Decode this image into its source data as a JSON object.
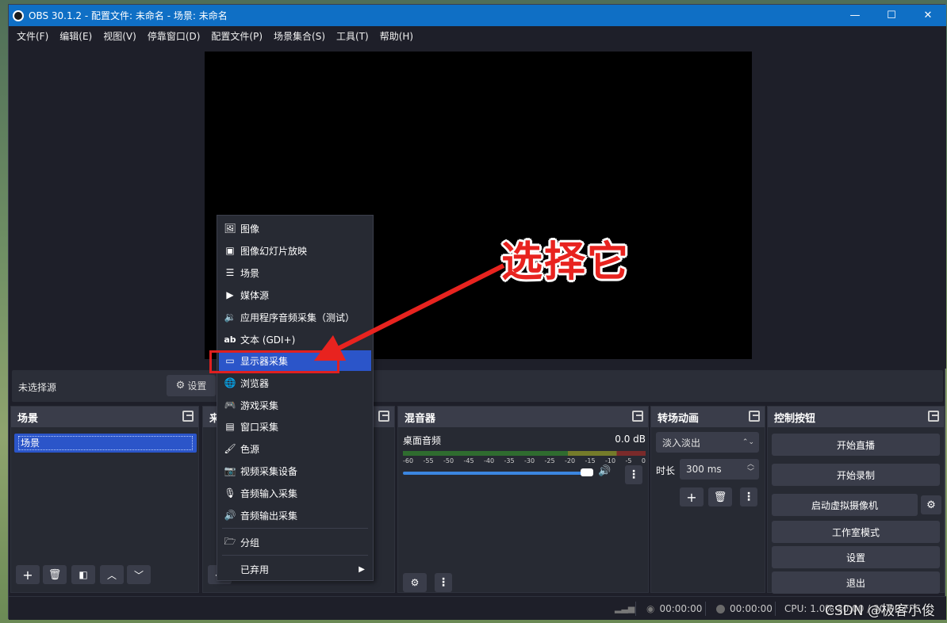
{
  "window": {
    "title": "OBS 30.1.2 - 配置文件: 未命名 - 场景: 未命名"
  },
  "menubar": [
    "文件(F)",
    "编辑(E)",
    "视图(V)",
    "停靠窗口(D)",
    "配置文件(P)",
    "场景集合(S)",
    "工具(T)",
    "帮助(H)"
  ],
  "source_bar": {
    "no_source": "未选择源",
    "settings": "设置"
  },
  "docks": {
    "scenes": {
      "title": "场景",
      "items": [
        "场景"
      ]
    },
    "sources": {
      "title": "来"
    },
    "mixer": {
      "title": "混音器",
      "track_name": "桌面音频",
      "track_db": "0.0 dB",
      "ticks": [
        "-60",
        "-55",
        "-50",
        "-45",
        "-40",
        "-35",
        "-30",
        "-25",
        "-20",
        "-15",
        "-10",
        "-5",
        "0"
      ],
      "volume_fraction": 1.0
    },
    "transitions": {
      "title": "转场动画",
      "transition": "淡入淡出",
      "duration_label": "时长",
      "duration": "300 ms"
    },
    "controls": {
      "title": "控制按钮",
      "buttons": [
        "开始直播",
        "开始录制",
        "启动虚拟摄像机",
        "工作室模式",
        "设置",
        "退出"
      ]
    }
  },
  "context_menu": {
    "items": [
      "图像",
      "图像幻灯片放映",
      "场景",
      "媒体源",
      "应用程序音频采集（测试）",
      "文本 (GDI+)",
      "显示器采集",
      "浏览器",
      "游戏采集",
      "窗口采集",
      "色源",
      "视频采集设备",
      "音频输入采集",
      "音频输出采集"
    ],
    "group": "分组",
    "deprecated": "已弃用",
    "selected": "显示器采集"
  },
  "annotation": {
    "text": "选择它",
    "color": "#e8231f"
  },
  "statusbar": {
    "stream_time": "00:00:00",
    "record_time": "00:00:00",
    "cpu": "CPU: 1.0%",
    "fps": "30.00 / 30.00 FPS"
  },
  "watermark": "CSDN @极客小俊",
  "colors": {
    "accent": "#2b55c9",
    "titlebar": "#0f6fc5",
    "annotation": "#e8231f"
  }
}
